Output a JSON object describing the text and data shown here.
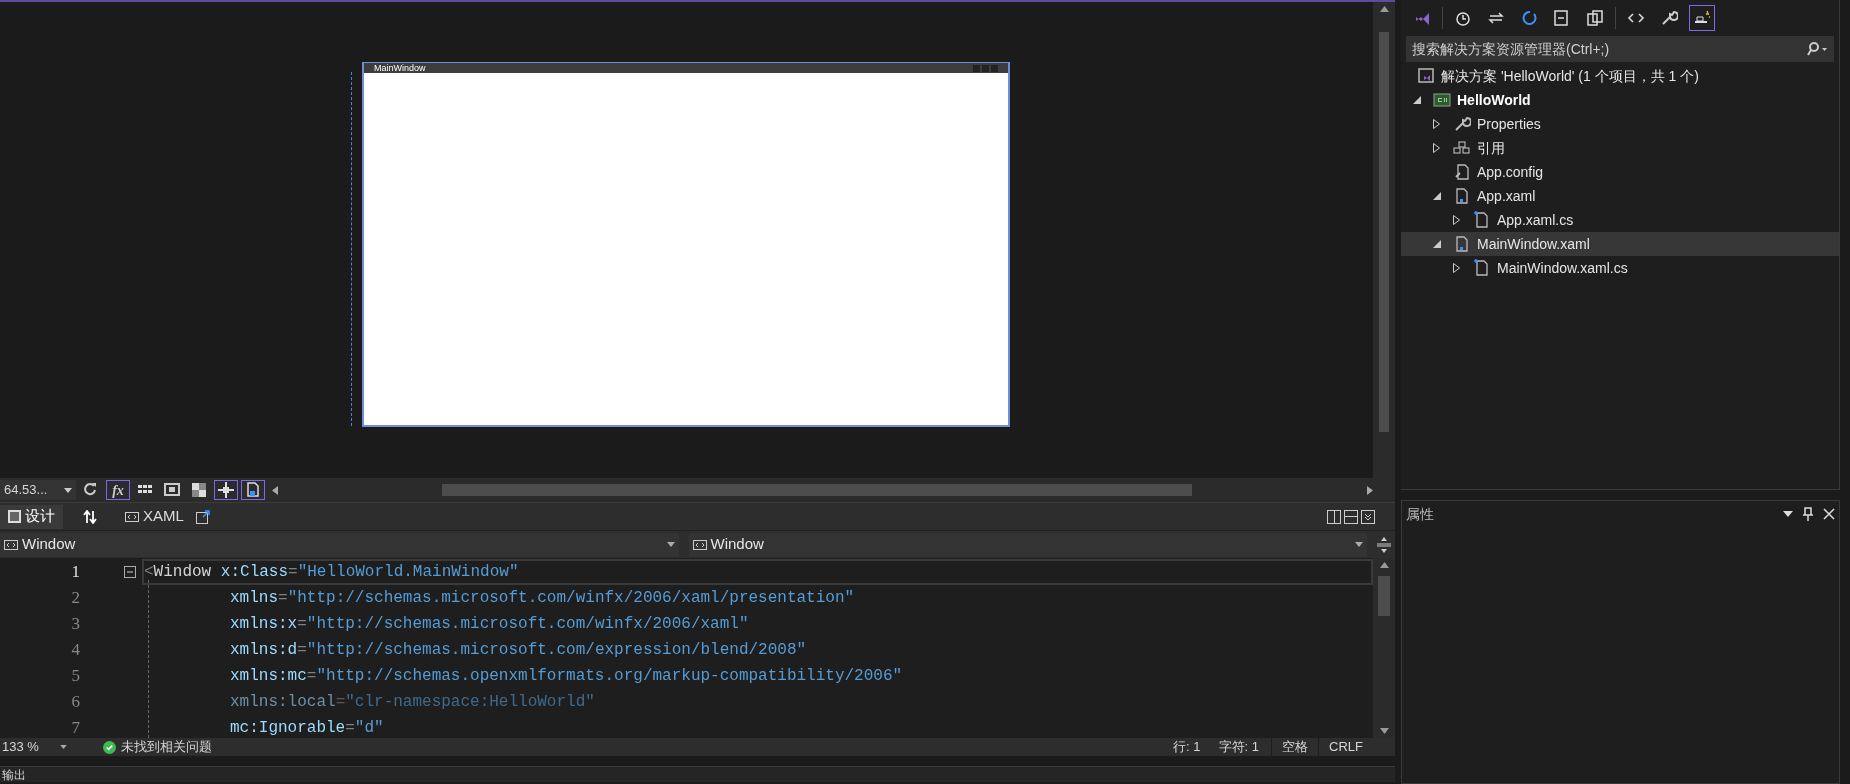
{
  "designer": {
    "window_title": "MainWindow"
  },
  "designer_toolbar": {
    "zoom": "64.53...",
    "buttons": [
      {
        "kind": "refresh",
        "on": false
      },
      {
        "kind": "fx",
        "label": "fx",
        "on": true
      },
      {
        "kind": "grid",
        "on": false
      },
      {
        "kind": "artboard",
        "on": false
      },
      {
        "kind": "checker",
        "on": false
      },
      {
        "kind": "snapgrid",
        "on": true
      },
      {
        "kind": "snaplines",
        "on": true
      }
    ]
  },
  "view_tabs": [
    {
      "label": "设计",
      "kind": "design",
      "selected": true
    },
    {
      "label": "XAML",
      "kind": "xaml",
      "selected": false
    }
  ],
  "nav_bar": {
    "left": "Window",
    "right": "Window"
  },
  "code_lines": [
    {
      "number": "1",
      "current": true,
      "dimmed": false,
      "tokens": [
        {
          "kind": "punct",
          "text": "<"
        },
        {
          "kind": "tag",
          "text": "Window"
        },
        {
          "kind": "attr",
          "text": " x:Class"
        },
        {
          "kind": "punct",
          "text": "="
        },
        {
          "kind": "value",
          "text": "\"HelloWorld.MainWindow\""
        }
      ]
    },
    {
      "number": "2",
      "current": false,
      "dimmed": false,
      "tokens": [
        {
          "kind": "attr",
          "text": "xmlns"
        },
        {
          "kind": "punct",
          "text": "="
        },
        {
          "kind": "value",
          "text": "\"http://schemas.microsoft.com/winfx/2006/xaml/presentation\""
        }
      ]
    },
    {
      "number": "3",
      "current": false,
      "dimmed": false,
      "tokens": [
        {
          "kind": "attr",
          "text": "xmlns:x"
        },
        {
          "kind": "punct",
          "text": "="
        },
        {
          "kind": "value",
          "text": "\"http://schemas.microsoft.com/winfx/2006/xaml\""
        }
      ]
    },
    {
      "number": "4",
      "current": false,
      "dimmed": false,
      "tokens": [
        {
          "kind": "attr",
          "text": "xmlns:d"
        },
        {
          "kind": "punct",
          "text": "="
        },
        {
          "kind": "value",
          "text": "\"http://schemas.microsoft.com/expression/blend/2008\""
        }
      ]
    },
    {
      "number": "5",
      "current": false,
      "dimmed": false,
      "tokens": [
        {
          "kind": "attr",
          "text": "xmlns:mc"
        },
        {
          "kind": "punct",
          "text": "="
        },
        {
          "kind": "value",
          "text": "\"http://schemas.openxmlformats.org/markup-compatibility/2006\""
        }
      ]
    },
    {
      "number": "6",
      "current": false,
      "dimmed": true,
      "tokens": [
        {
          "kind": "attr",
          "text": "xmlns:local"
        },
        {
          "kind": "punct",
          "text": "="
        },
        {
          "kind": "value",
          "text": "\"clr-namespace:HelloWorld\""
        }
      ]
    },
    {
      "number": "7",
      "current": false,
      "dimmed": false,
      "tokens": [
        {
          "kind": "attr",
          "text": "mc:Ignorable"
        },
        {
          "kind": "punct",
          "text": "="
        },
        {
          "kind": "value",
          "text": "\"d\""
        }
      ]
    }
  ],
  "editor_status": {
    "zoom": "133 %",
    "issues": "未找到相关问题",
    "line": "行: 1",
    "column": "字符: 1",
    "indent": "空格",
    "line_ending": "CRLF"
  },
  "output_panel": {
    "title": "输出"
  },
  "solution_explorer": {
    "toolbar": [
      {
        "kind": "vs",
        "on": false
      },
      {
        "kind": "history",
        "on": false
      },
      {
        "kind": "sync",
        "on": false
      },
      {
        "kind": "refresh",
        "on": false
      },
      {
        "kind": "collapse",
        "on": false
      },
      {
        "kind": "copies",
        "on": false
      },
      {
        "kind": "code",
        "on": false
      },
      {
        "kind": "wrench",
        "on": false
      },
      {
        "kind": "preview",
        "on": true
      }
    ],
    "search_placeholder": "搜索解决方案资源管理器(Ctrl+;)",
    "tree": [
      {
        "label": "解决方案 'HelloWorld' (1 个项目，共 1 个)",
        "kind": "solution",
        "selected": false,
        "children": [
          {
            "label": "HelloWorld",
            "kind": "project",
            "expanded": true,
            "selected": false,
            "children": [
              {
                "label": "Properties",
                "kind": "properties",
                "expanded": false,
                "selected": false
              },
              {
                "label": "引用",
                "kind": "references",
                "expanded": false,
                "selected": false
              },
              {
                "label": "App.config",
                "kind": "config",
                "selected": false
              },
              {
                "label": "App.xaml",
                "kind": "xaml",
                "expanded": true,
                "selected": false,
                "children": [
                  {
                    "label": "App.xaml.cs",
                    "kind": "cs",
                    "expanded": false,
                    "selected": false
                  }
                ]
              },
              {
                "label": "MainWindow.xaml",
                "kind": "xaml",
                "expanded": true,
                "selected": true,
                "children": [
                  {
                    "label": "MainWindow.xaml.cs",
                    "kind": "cs",
                    "expanded": false,
                    "selected": false
                  }
                ]
              }
            ]
          }
        ]
      }
    ]
  },
  "properties_panel": {
    "title": "属性"
  }
}
